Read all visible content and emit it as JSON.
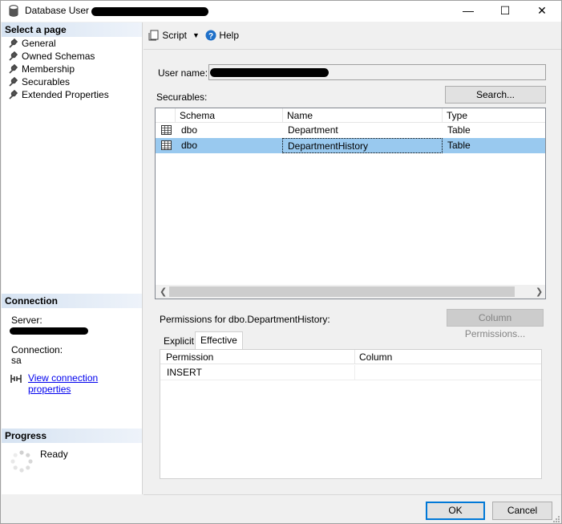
{
  "window": {
    "title": "Database User -",
    "controls": [
      "—",
      "☐",
      "✕"
    ]
  },
  "left": {
    "select_page_header": "Select a page",
    "pages": [
      {
        "label": "General"
      },
      {
        "label": "Owned Schemas"
      },
      {
        "label": "Membership"
      },
      {
        "label": "Securables"
      },
      {
        "label": "Extended Properties"
      }
    ],
    "connection_header": "Connection",
    "server_label": "Server:",
    "connection_label": "Connection:",
    "connection_value": "sa",
    "view_props_link": "View connection properties",
    "progress_header": "Progress",
    "progress_status": "Ready"
  },
  "toolbar": {
    "script_label": "Script",
    "help_label": "Help"
  },
  "form": {
    "user_name_label": "User name:",
    "securables_label": "Securables:",
    "search_button": "Search...",
    "securables_columns": [
      "Schema",
      "Name",
      "Type"
    ],
    "securables_rows": [
      {
        "schema": "dbo",
        "name": "Department",
        "type": "Table"
      },
      {
        "schema": "dbo",
        "name": "DepartmentHistory",
        "type": "Table"
      }
    ],
    "permissions_label": "Permissions for dbo.DepartmentHistory:",
    "column_permissions_button": "Column Permissions...",
    "tabs": [
      {
        "label": "Explicit"
      },
      {
        "label": "Effective"
      }
    ],
    "perm_columns": [
      "Permission",
      "Column"
    ],
    "perm_rows": [
      {
        "permission": "INSERT",
        "column": ""
      }
    ]
  },
  "footer": {
    "ok_button": "OK",
    "cancel_button": "Cancel"
  },
  "colors": {
    "selection": "#99c9ef",
    "link": "#0000ee",
    "section_header": "#d6e3f2"
  }
}
